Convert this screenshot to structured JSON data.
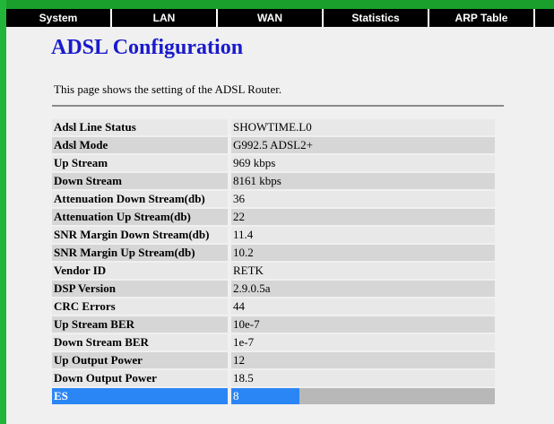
{
  "nav": {
    "items": [
      {
        "label": "System"
      },
      {
        "label": "LAN"
      },
      {
        "label": "WAN"
      },
      {
        "label": "Statistics"
      },
      {
        "label": "ARP Table"
      }
    ]
  },
  "page": {
    "title": "ADSL Configuration",
    "description": "This page shows the setting of the ADSL Router."
  },
  "rows": [
    {
      "label": "Adsl Line Status",
      "value": "SHOWTIME.L0"
    },
    {
      "label": "Adsl Mode",
      "value": "G992.5 ADSL2+"
    },
    {
      "label": "Up Stream",
      "value": "969 kbps"
    },
    {
      "label": "Down Stream",
      "value": "8161 kbps"
    },
    {
      "label": "Attenuation Down Stream(db)",
      "value": "36"
    },
    {
      "label": "Attenuation Up Stream(db)",
      "value": "22"
    },
    {
      "label": "SNR Margin Down Stream(db)",
      "value": "11.4"
    },
    {
      "label": "SNR Margin Up Stream(db)",
      "value": "10.2"
    },
    {
      "label": "Vendor ID",
      "value": "RETK"
    },
    {
      "label": "DSP Version",
      "value": "2.9.0.5a"
    },
    {
      "label": "CRC Errors",
      "value": "44"
    },
    {
      "label": "Up Stream BER",
      "value": "10e-7"
    },
    {
      "label": "Down Stream BER",
      "value": "1e-7"
    },
    {
      "label": "Up Output Power",
      "value": "12"
    },
    {
      "label": "Down Output Power",
      "value": "18.5"
    },
    {
      "label": "ES",
      "value": "8"
    }
  ],
  "colors": {
    "nav_background": "#000000",
    "title": "#1a1acc",
    "selection": "#2b86f5",
    "frame_green": "#22b53a"
  }
}
